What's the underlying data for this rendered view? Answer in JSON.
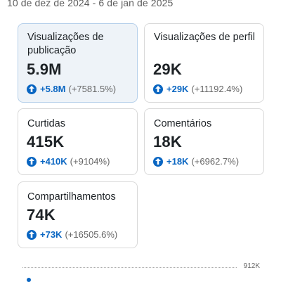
{
  "date_range": "10 de dez de 2024 - 6 de jan de 2025",
  "metrics": [
    {
      "label": "Visualizações de publicação",
      "value": "5.9M",
      "delta": "+5.8M",
      "pct": "(+7581.5%)"
    },
    {
      "label": "Visualizações de perfil",
      "value": "29K",
      "delta": "+29K",
      "pct": "(+11192.4%)"
    },
    {
      "label": "Curtidas",
      "value": "415K",
      "delta": "+410K",
      "pct": "(+9104%)"
    },
    {
      "label": "Comentários",
      "value": "18K",
      "delta": "+18K",
      "pct": "(+6962.7%)"
    },
    {
      "label": "Compartilhamentos",
      "value": "74K",
      "delta": "+73K",
      "pct": "(+16505.6%)"
    }
  ],
  "chart": {
    "y_tick": "912K"
  },
  "icons": {
    "trend": "arrow-up-circle-icon"
  },
  "colors": {
    "accent": "#0a66c2",
    "selected_bg": "#eef3f8"
  }
}
